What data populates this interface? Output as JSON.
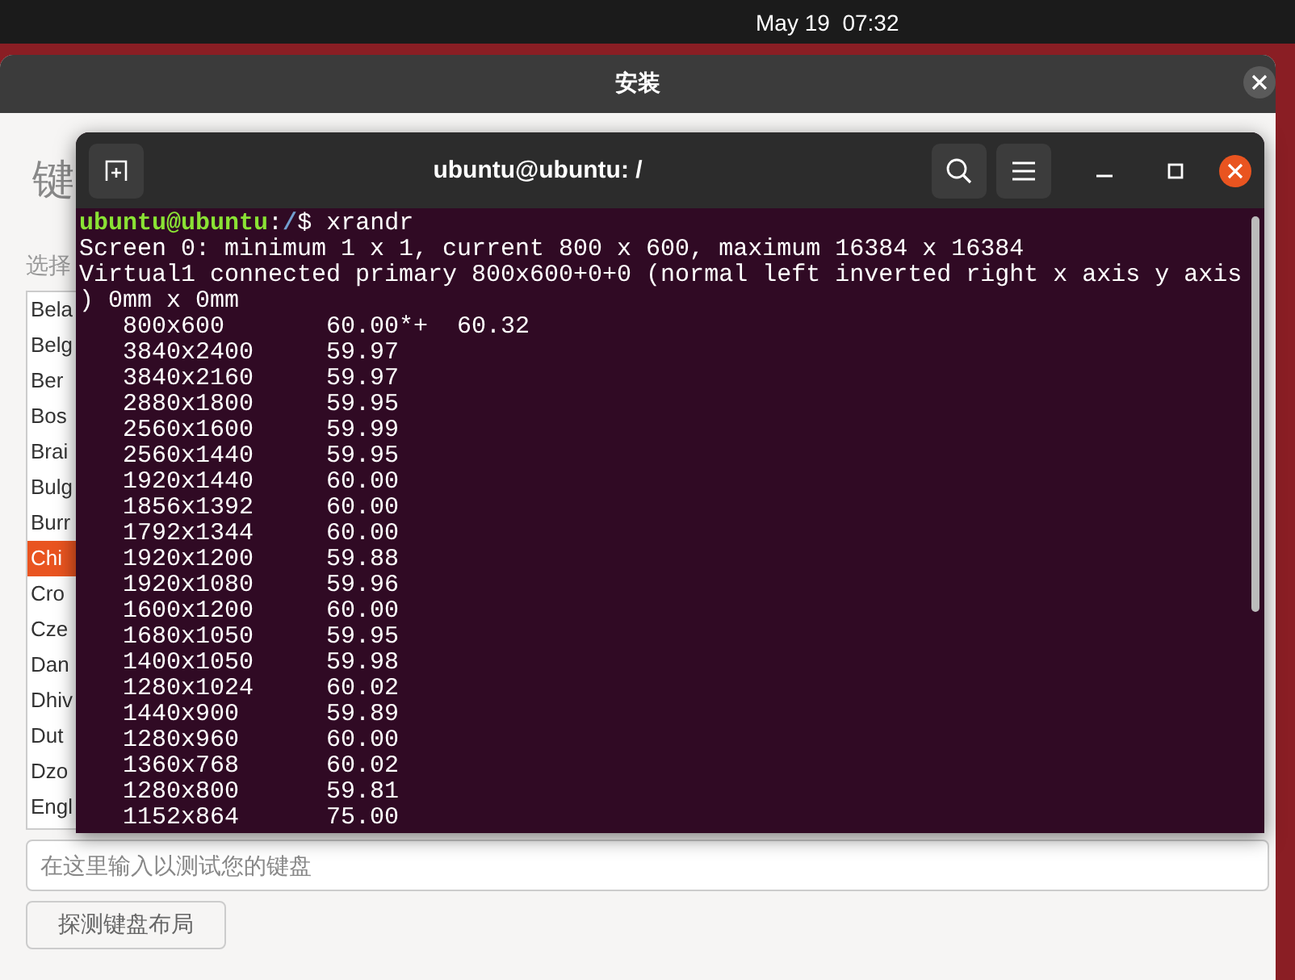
{
  "top_bar": {
    "clock": "May 19  07:32"
  },
  "installer": {
    "title": "安装",
    "heading": "键",
    "prompt": "选择",
    "layouts": [
      {
        "label": "Bela",
        "selected": false
      },
      {
        "label": "Belg",
        "selected": false
      },
      {
        "label": "Ber",
        "selected": false
      },
      {
        "label": "Bos",
        "selected": false
      },
      {
        "label": "Brai",
        "selected": false
      },
      {
        "label": "Bulg",
        "selected": false
      },
      {
        "label": "Burr",
        "selected": false
      },
      {
        "label": "Chi",
        "selected": true
      },
      {
        "label": "Cro",
        "selected": false
      },
      {
        "label": "Cze",
        "selected": false
      },
      {
        "label": "Dan",
        "selected": false
      },
      {
        "label": "Dhiv",
        "selected": false
      },
      {
        "label": "Dut",
        "selected": false
      },
      {
        "label": "Dzo",
        "selected": false
      },
      {
        "label": "Engl",
        "selected": false
      }
    ],
    "test_field": {
      "placeholder": "在这里输入以测试您的键盘"
    },
    "detect_button": "探测键盘布局"
  },
  "terminal": {
    "title": "ubuntu@ubuntu: /",
    "prompt": {
      "user": "ubuntu@ubuntu",
      "separator": ":",
      "path": "/",
      "symbol": "$",
      "command": "xrandr"
    },
    "output": [
      "Screen 0: minimum 1 x 1, current 800 x 600, maximum 16384 x 16384",
      "Virtual1 connected primary 800x600+0+0 (normal left inverted right x axis y axis",
      ") 0mm x 0mm",
      "   800x600       60.00*+  60.32",
      "   3840x2400     59.97",
      "   3840x2160     59.97",
      "   2880x1800     59.95",
      "   2560x1600     59.99",
      "   2560x1440     59.95",
      "   1920x1440     60.00",
      "   1856x1392     60.00",
      "   1792x1344     60.00",
      "   1920x1200     59.88",
      "   1920x1080     59.96",
      "   1600x1200     60.00",
      "   1680x1050     59.95",
      "   1400x1050     59.98",
      "   1280x1024     60.02",
      "   1440x900      59.89",
      "   1280x960      60.00",
      "   1360x768      60.02",
      "   1280x800      59.81",
      "   1152x864      75.00"
    ]
  }
}
